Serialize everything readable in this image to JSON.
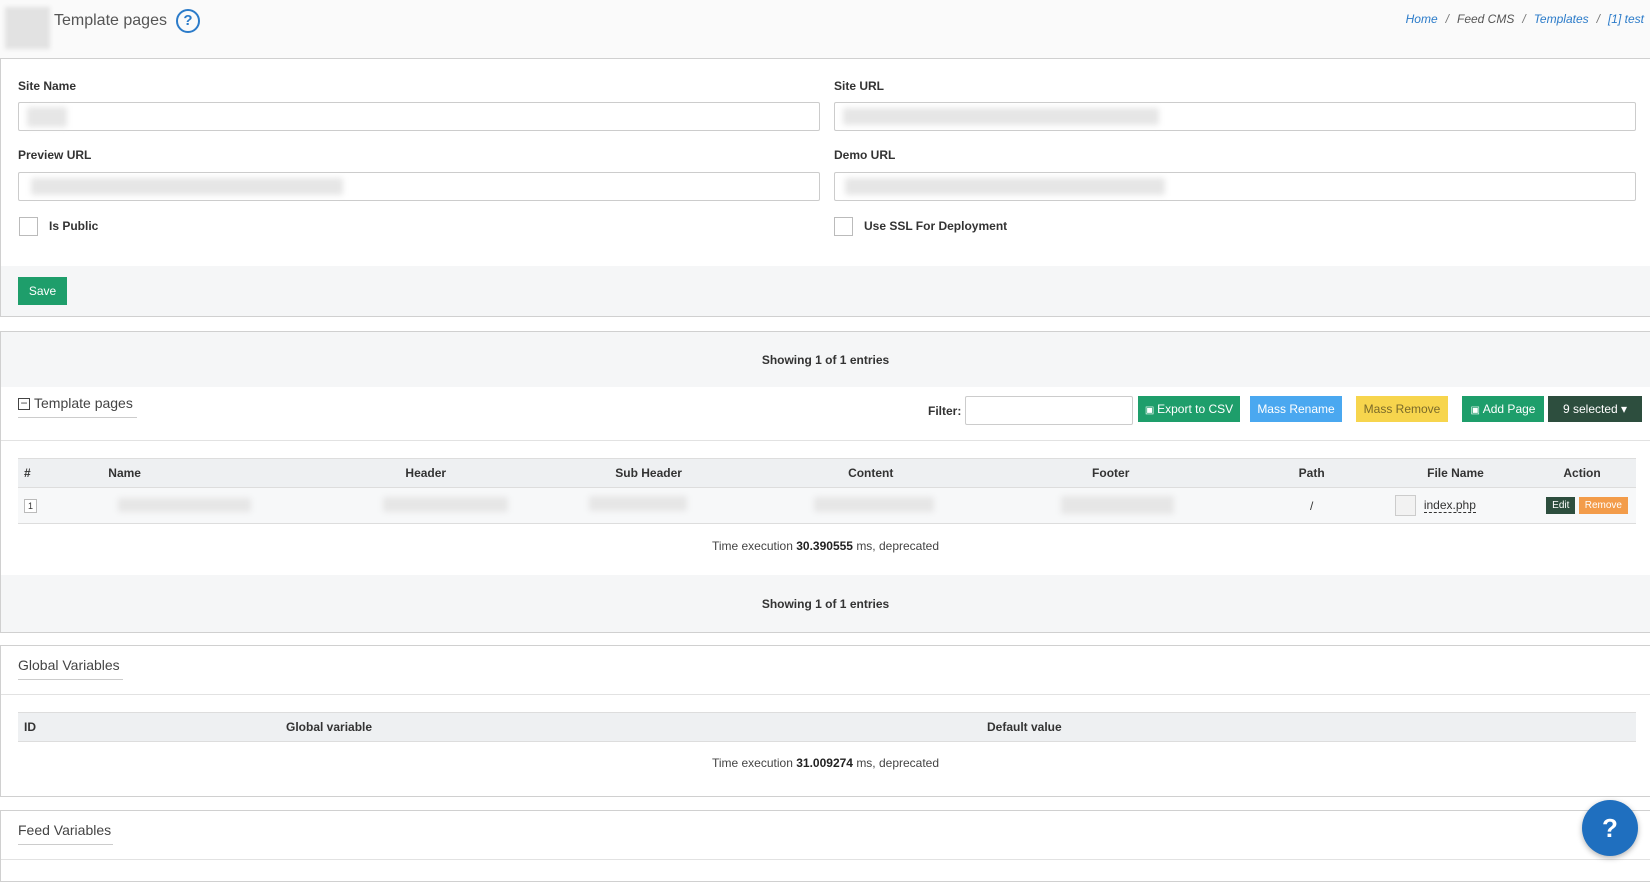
{
  "header": {
    "title": "Template pages",
    "help_icon": "?",
    "breadcrumb": [
      "Home",
      "Feed CMS",
      "Templates",
      "[1] test"
    ],
    "separator": "/"
  },
  "site_form": {
    "site_name_label": "Site Name",
    "site_url_label": "Site URL",
    "preview_url_label": "Preview URL",
    "demo_url_label": "Demo URL",
    "is_public_label": "Is Public",
    "use_ssl_label": "Use SSL For Deployment",
    "save_label": "Save"
  },
  "template_pages": {
    "showing_top": "Showing 1 of 1 entries",
    "section_title": "Template pages",
    "collapse_icon": "−",
    "filter_label": "Filter:",
    "export_label": "Export to CSV",
    "mass_rename_label": "Mass Rename",
    "mass_remove_label": "Mass Remove",
    "add_page_label": "Add Page",
    "selected_label": "9 selected ▾",
    "columns": [
      "#",
      "Name",
      "Header",
      "Sub Header",
      "Content",
      "Footer",
      "Path",
      "File Name",
      "Action"
    ],
    "row": {
      "index": "1",
      "path": "/",
      "file_name": "index.php",
      "edit_label": "Edit",
      "remove_label": "Remove"
    },
    "exec_prefix": "Time execution",
    "exec_value": "30.390555",
    "exec_suffix": "ms, deprecated",
    "showing_bottom": "Showing 1 of 1 entries"
  },
  "global_variables": {
    "section_title": "Global Variables",
    "columns": [
      "ID",
      "Global variable",
      "Default value"
    ],
    "exec_prefix": "Time execution",
    "exec_value": "31.009274",
    "exec_suffix": "ms, deprecated"
  },
  "feed_variables": {
    "section_title": "Feed Variables"
  },
  "colors": {
    "accent_blue": "#2b7bc9",
    "green": "#1e9e6b",
    "light_blue": "#4aa8f0",
    "yellow": "#f7d54d",
    "dark_green": "#2d4e3e",
    "orange": "#f39c4a"
  }
}
